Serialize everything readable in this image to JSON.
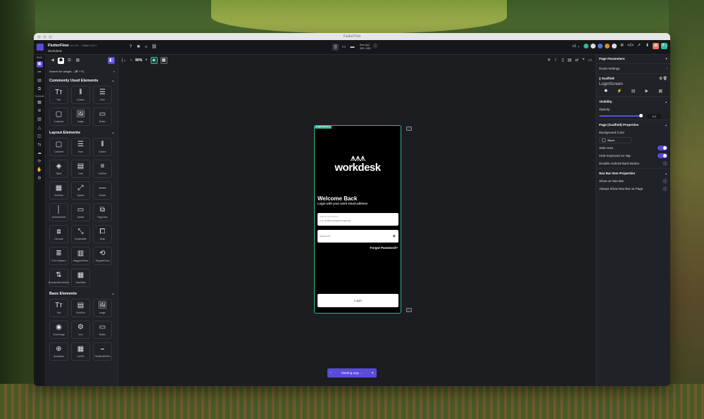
{
  "window": {
    "title": "FlutterFlow"
  },
  "topbar": {
    "app_name": "FlutterFlow",
    "app_version": "v4.1.34 — Flutter 3.19.1",
    "project_name": "Workdesk",
    "device_name": "Size (px)",
    "device_size": "393 × 852",
    "version_select": "v1"
  },
  "rail": {
    "build_label": "Build",
    "connect_label": "Connect"
  },
  "widgets": {
    "search_placeholder": "Search for widget... (⌘ + F)",
    "sections": [
      {
        "title": "Commonly Used Elements",
        "items": [
          {
            "label": "Text",
            "icon": "Tт"
          },
          {
            "label": "Column",
            "icon": "⫴"
          },
          {
            "label": "Row",
            "icon": "☰"
          },
          {
            "label": "Container",
            "icon": "▢"
          },
          {
            "label": "Image",
            "icon": "🖼"
          },
          {
            "label": "Button",
            "icon": "▭"
          }
        ]
      },
      {
        "title": "Layout Elements",
        "items": [
          {
            "label": "Container",
            "icon": "▢"
          },
          {
            "label": "Row",
            "icon": "☰"
          },
          {
            "label": "Column",
            "icon": "⫴"
          },
          {
            "label": "Stack",
            "icon": "◈"
          },
          {
            "label": "Card",
            "icon": "▤"
          },
          {
            "label": "ListView",
            "icon": "≡"
          },
          {
            "label": "GridView",
            "icon": "▦"
          },
          {
            "label": "Spacer",
            "icon": "⤢"
          },
          {
            "label": "Divider",
            "icon": "—"
          },
          {
            "label": "VerticalDivider",
            "icon": "│"
          },
          {
            "label": "TabBar",
            "icon": "▭"
          },
          {
            "label": "PageView",
            "icon": "⧉"
          },
          {
            "label": "Carousel",
            "icon": "⧈"
          },
          {
            "label": "Expandable",
            "icon": "⤡"
          },
          {
            "label": "Wrap",
            "icon": "⧠"
          },
          {
            "label": "Form Validator",
            "icon": "≣"
          },
          {
            "label": "StaggeredView",
            "icon": "▥"
          },
          {
            "label": "FlippableCard",
            "icon": "⟲"
          },
          {
            "label": "ReorderableListView",
            "icon": "⇅"
          },
          {
            "label": "DataTable",
            "icon": "▦"
          }
        ]
      },
      {
        "title": "Base Elements",
        "items": [
          {
            "label": "Text",
            "icon": "Tт"
          },
          {
            "label": "RichText",
            "icon": "▤"
          },
          {
            "label": "Image",
            "icon": "🖼"
          },
          {
            "label": "CircleImage",
            "icon": "◉"
          },
          {
            "label": "Icon",
            "icon": "⚙"
          },
          {
            "label": "Button",
            "icon": "▭"
          },
          {
            "label": "IconButton",
            "icon": "⊕"
          },
          {
            "label": "ListTile",
            "icon": "▦"
          },
          {
            "label": "DividerWithText",
            "icon": "⎯"
          }
        ]
      }
    ]
  },
  "canvas": {
    "zoom": "90%",
    "screen_tag": "LoginScreen",
    "brand_text": "workdesk",
    "welcome_title": "Welcome Back",
    "welcome_subtitle": "Login with your work email address",
    "email_label": "Work email address",
    "email_placeholder": "e.g. am@workspace.agency",
    "password_placeholder": "password",
    "forgot_password": "Forgot Password?",
    "login_button": "Login",
    "toast": "Starting App..."
  },
  "props": {
    "page_parameters": "Page Parameters",
    "route_settings": "Route Settings",
    "widget_type": "Scaffold",
    "widget_name": "LoginScreen",
    "visibility": "Visibility",
    "opacity_label": "Opacity",
    "opacity_value": "1.0",
    "opacity": 1.0,
    "scaffold_props": "Page (Scaffold) Properties",
    "bg_color_label": "Background Color",
    "bg_color_value": "Black",
    "safe_area": "Safe Area",
    "hide_keyboard": "Hide Keyboard on Tap",
    "disable_back": "Disable Android Back Button",
    "nav_bar_props": "Nav Bar Item Properties",
    "show_nav": "Show on Nav Bar",
    "always_show": "Always Show Nav Bar on Page"
  },
  "colors": {
    "accent": "#5b4bdb",
    "teal": "#2fb79a"
  }
}
